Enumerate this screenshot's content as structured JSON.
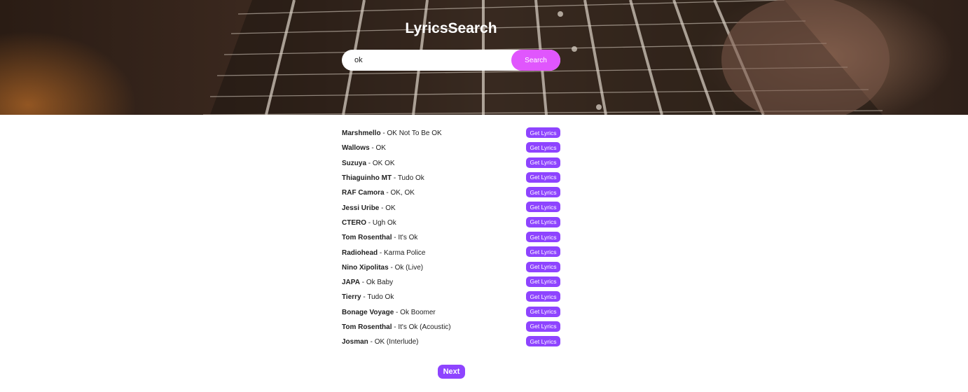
{
  "app": {
    "title": "LyricsSearch"
  },
  "search": {
    "value": "ok",
    "button_label": "Search"
  },
  "results": [
    {
      "artist": "Marshmello",
      "title": "OK Not To Be OK",
      "button_label": "Get Lyrics"
    },
    {
      "artist": "Wallows",
      "title": "OK",
      "button_label": "Get Lyrics"
    },
    {
      "artist": "Suzuya",
      "title": "OK OK",
      "button_label": "Get Lyrics"
    },
    {
      "artist": "Thiaguinho MT",
      "title": "Tudo Ok",
      "button_label": "Get Lyrics"
    },
    {
      "artist": "RAF Camora",
      "title": "OK, OK",
      "button_label": "Get Lyrics"
    },
    {
      "artist": "Jessi Uribe",
      "title": "OK",
      "button_label": "Get Lyrics"
    },
    {
      "artist": "CTERO",
      "title": "Ugh Ok",
      "button_label": "Get Lyrics"
    },
    {
      "artist": "Tom Rosenthal",
      "title": "It's Ok",
      "button_label": "Get Lyrics"
    },
    {
      "artist": "Radiohead",
      "title": "Karma Police",
      "button_label": "Get Lyrics"
    },
    {
      "artist": "Nino Xipolitas",
      "title": "Ok (Live)",
      "button_label": "Get Lyrics"
    },
    {
      "artist": "JAPA",
      "title": "Ok Baby",
      "button_label": "Get Lyrics"
    },
    {
      "artist": "Tierry",
      "title": "Tudo Ok",
      "button_label": "Get Lyrics"
    },
    {
      "artist": "Bonage Voyage",
      "title": "Ok Boomer",
      "button_label": "Get Lyrics"
    },
    {
      "artist": "Tom Rosenthal",
      "title": "It's Ok (Acoustic)",
      "button_label": "Get Lyrics"
    },
    {
      "artist": "Josman",
      "title": "OK (Interlude)",
      "button_label": "Get Lyrics"
    }
  ],
  "pagination": {
    "next_label": "Next"
  },
  "colors": {
    "search_button": "#e056fd",
    "accent": "#8e44ff"
  }
}
